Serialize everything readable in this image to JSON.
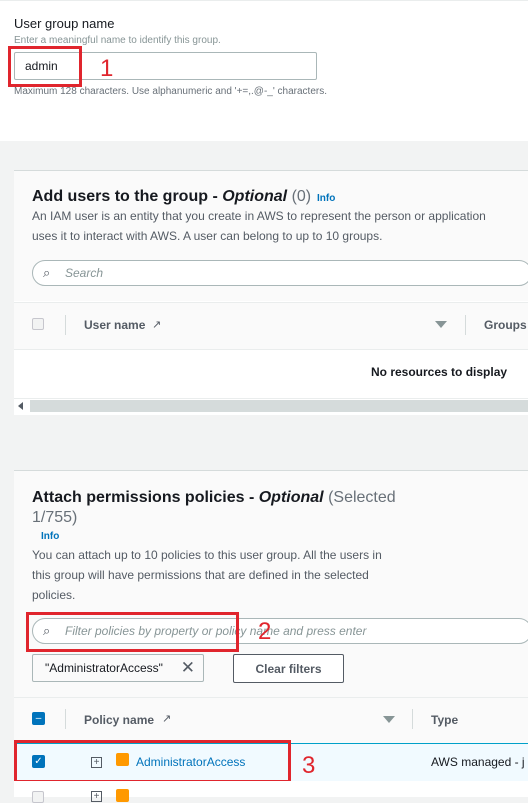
{
  "group_name": {
    "label": "User group name",
    "hint": "Enter a meaningful name to identify this group.",
    "value": "admin",
    "constraint": "Maximum 128 characters. Use alphanumeric and '+=,.@-_' characters."
  },
  "add_users": {
    "title": "Add users to the group - ",
    "optional": "Optional",
    "count": "(0)",
    "info": "Info",
    "description_line1": "An IAM user is an entity that you create in AWS to represent the person or application",
    "description_line2": "uses it to interact with AWS. A user can belong to up to 10 groups.",
    "search_placeholder": "Search",
    "columns": [
      "User name",
      "Groups"
    ],
    "empty_text": "No resources to display"
  },
  "permissions": {
    "title": "Attach permissions policies - ",
    "optional": "Optional",
    "selected_a": "(Selected",
    "selected_b": "1/755)",
    "info": "Info",
    "description_lines": [
      "You can attach up to 10 policies to this user group. All the users in",
      "this group will have permissions that are defined in the selected",
      "policies."
    ],
    "filter_placeholder": "Filter policies by property or policy name and press enter",
    "token": "\"AdministratorAccess\"",
    "clear_filters": "Clear filters",
    "columns": [
      "Policy name",
      "Type"
    ],
    "row": {
      "name": "AdministratorAccess",
      "type": "AWS managed - j"
    }
  },
  "annotations": [
    "1",
    "2",
    "3"
  ],
  "colors": {
    "annotation": "#e0252d",
    "link": "#0073bb",
    "aws_orange": "#ff9900"
  }
}
